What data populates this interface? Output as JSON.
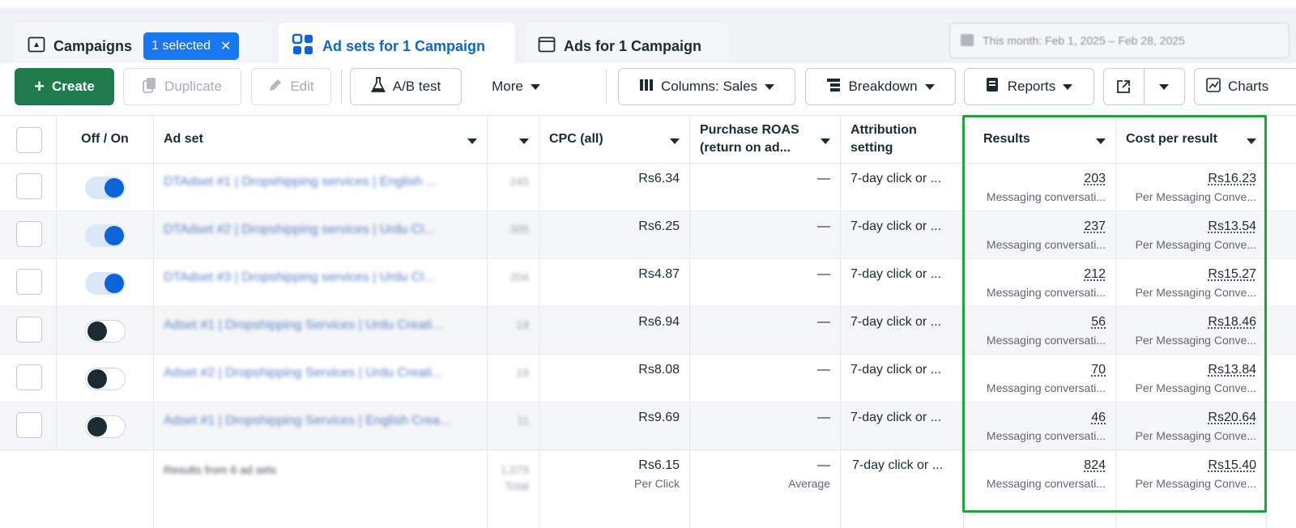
{
  "tabs": {
    "campaigns_label": "Campaigns",
    "selected_badge": "1 selected",
    "adsets_label": "Ad sets for 1 Campaign",
    "ads_label": "Ads for 1 Campaign",
    "date_range": "This month: Feb 1, 2025 – Feb 28, 2025"
  },
  "toolbar": {
    "create": "Create",
    "duplicate": "Duplicate",
    "edit": "Edit",
    "ab_test": "A/B test",
    "more": "More",
    "columns": "Columns: Sales",
    "breakdown": "Breakdown",
    "reports": "Reports",
    "charts": "Charts"
  },
  "columns": {
    "off_on": "Off / On",
    "ad_set": "Ad set",
    "cpc": "CPC (all)",
    "purchase_roas": "Purchase ROAS (return on ad...",
    "attribution": "Attribution setting",
    "results": "Results",
    "cost_per_result": "Cost per result"
  },
  "rows": [
    {
      "state": "on",
      "name": "DTAdset #1 | Dropshipping services | English ...",
      "extra": "245",
      "cpc": "Rs6.34",
      "roas": "—",
      "attribution": "7-day click or ...",
      "results": "203",
      "results_sub": "Messaging conversati...",
      "cost": "Rs16.23",
      "cost_sub": "Per Messaging Conve..."
    },
    {
      "state": "on",
      "name": "DTAdset #2 | Dropshipping services | Urdu Cl...",
      "extra": "305",
      "cpc": "Rs6.25",
      "roas": "—",
      "attribution": "7-day click or ...",
      "results": "237",
      "results_sub": "Messaging conversati...",
      "cost": "Rs13.54",
      "cost_sub": "Per Messaging Conve..."
    },
    {
      "state": "on",
      "name": "DTAdset #3 | Dropshipping services | Urdu Cl...",
      "extra": "204",
      "cpc": "Rs4.87",
      "roas": "—",
      "attribution": "7-day click or ...",
      "results": "212",
      "results_sub": "Messaging conversati...",
      "cost": "Rs15.27",
      "cost_sub": "Per Messaging Conve..."
    },
    {
      "state": "off",
      "name": "Adset #1 | Dropshipping Services | Urdu Creati...",
      "extra": "19",
      "cpc": "Rs6.94",
      "roas": "—",
      "attribution": "7-day click or ...",
      "results": "56",
      "results_sub": "Messaging conversati...",
      "cost": "Rs18.46",
      "cost_sub": "Per Messaging Conve..."
    },
    {
      "state": "off",
      "name": "Adset #2 | Dropshipping Services | Urdu Creati...",
      "extra": "19",
      "cpc": "Rs8.08",
      "roas": "—",
      "attribution": "7-day click or ...",
      "results": "70",
      "results_sub": "Messaging conversati...",
      "cost": "Rs13.84",
      "cost_sub": "Per Messaging Conve..."
    },
    {
      "state": "off",
      "name": "Adset #1 | Dropshipping Services | English Crea...",
      "extra": "11",
      "cpc": "Rs9.69",
      "roas": "—",
      "attribution": "7-day click or ...",
      "results": "46",
      "results_sub": "Messaging conversati...",
      "cost": "Rs20.64",
      "cost_sub": "Per Messaging Conve..."
    }
  ],
  "total": {
    "label": "Results from 6 ad sets",
    "extra": "1,079",
    "extra_sub": "Total",
    "cpc": "Rs6.15",
    "cpc_sub": "Per Click",
    "roas": "—",
    "roas_sub": "Average",
    "attribution": "7-day click or ...",
    "results": "824",
    "results_sub": "Messaging conversati...",
    "cost": "Rs15.40",
    "cost_sub": "Per Messaging Conve..."
  },
  "colors": {
    "create_button": "#1f7a4c",
    "active_tab_text": "#0a66d8",
    "badge": "#1877f2",
    "toggle_on": "#0a66d8",
    "highlight_box": "#1fa33a"
  }
}
